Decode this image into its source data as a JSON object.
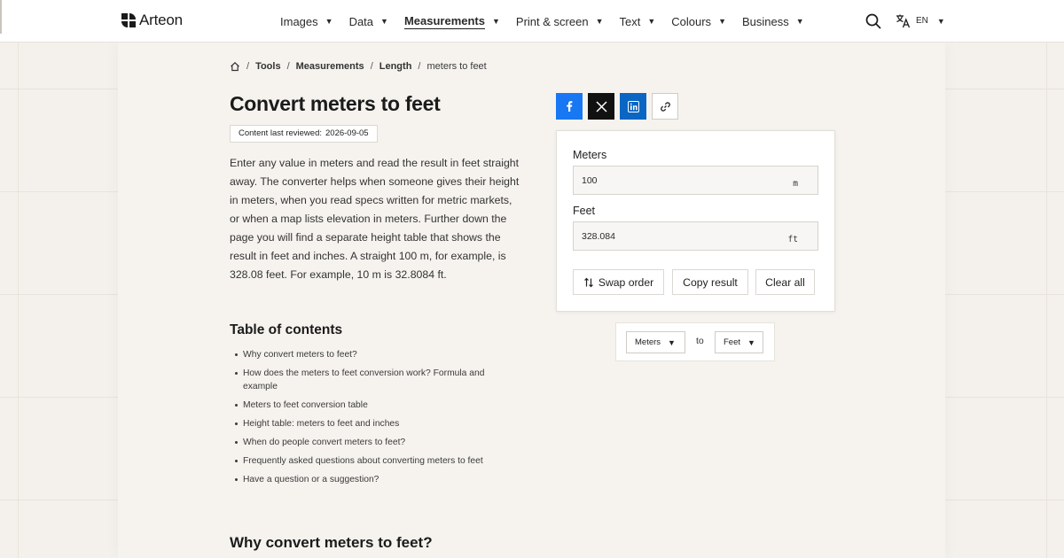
{
  "header": {
    "logo_text": "Arteon",
    "nav": [
      {
        "label": "Images",
        "active": false
      },
      {
        "label": "Data",
        "active": false
      },
      {
        "label": "Measurements",
        "active": true
      },
      {
        "label": "Print & screen",
        "active": false
      },
      {
        "label": "Text",
        "active": false
      },
      {
        "label": "Colours",
        "active": false
      },
      {
        "label": "Business",
        "active": false
      }
    ],
    "caret": "▼",
    "language": "EN"
  },
  "breadcrumb": {
    "items": [
      "Tools",
      "Measurements",
      "Length"
    ],
    "current": "meters to feet",
    "separator": "/"
  },
  "page": {
    "title": "Convert meters to feet",
    "reviewed_label": "Content last reviewed:",
    "reviewed_date": "2026-09-05",
    "intro": "Enter any value in meters and read the result in feet straight away. The converter helps when someone gives their height in meters, when you read specs written for metric markets, or when a map lists elevation in meters. Further down the page you will find a separate height table that shows the result in feet and inches. A straight 100 m, for example, is 328.08 feet. For example, 10 m is 32.8084 ft.",
    "toc_title": "Table of contents",
    "toc": [
      "Why convert meters to feet?",
      "How does the meters to feet conversion work? Formula and example",
      "Meters to feet conversion table",
      "Height table: meters to feet and inches",
      "When do people convert meters to feet?",
      "Frequently asked questions about converting meters to feet",
      "Have a question or a suggestion?"
    ],
    "section_title": "Why convert meters to feet?"
  },
  "converter": {
    "from_label": "Meters",
    "from_value": "100",
    "from_unit": "m",
    "to_label": "Feet",
    "to_value": "328.084",
    "to_unit": "ft",
    "swap_label": "Swap order",
    "copy_label": "Copy result",
    "clear_label": "Clear all",
    "unit_from": "Meters",
    "unit_to": "Feet",
    "to_word": "to"
  },
  "colors": {
    "facebook": "#1877f2",
    "x": "#111111",
    "linkedin": "#0a66c2",
    "background": "#f4f1ec"
  }
}
